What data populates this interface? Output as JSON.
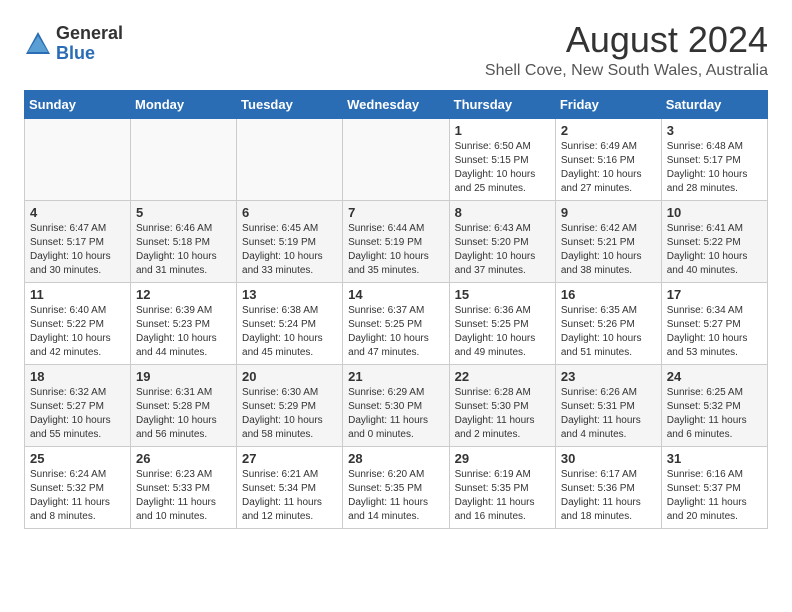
{
  "logo": {
    "general": "General",
    "blue": "Blue"
  },
  "title": {
    "month_year": "August 2024",
    "location": "Shell Cove, New South Wales, Australia"
  },
  "days_header": [
    "Sunday",
    "Monday",
    "Tuesday",
    "Wednesday",
    "Thursday",
    "Friday",
    "Saturday"
  ],
  "weeks": [
    [
      {
        "day": "",
        "info": ""
      },
      {
        "day": "",
        "info": ""
      },
      {
        "day": "",
        "info": ""
      },
      {
        "day": "",
        "info": ""
      },
      {
        "day": "1",
        "info": "Sunrise: 6:50 AM\nSunset: 5:15 PM\nDaylight: 10 hours\nand 25 minutes."
      },
      {
        "day": "2",
        "info": "Sunrise: 6:49 AM\nSunset: 5:16 PM\nDaylight: 10 hours\nand 27 minutes."
      },
      {
        "day": "3",
        "info": "Sunrise: 6:48 AM\nSunset: 5:17 PM\nDaylight: 10 hours\nand 28 minutes."
      }
    ],
    [
      {
        "day": "4",
        "info": "Sunrise: 6:47 AM\nSunset: 5:17 PM\nDaylight: 10 hours\nand 30 minutes."
      },
      {
        "day": "5",
        "info": "Sunrise: 6:46 AM\nSunset: 5:18 PM\nDaylight: 10 hours\nand 31 minutes."
      },
      {
        "day": "6",
        "info": "Sunrise: 6:45 AM\nSunset: 5:19 PM\nDaylight: 10 hours\nand 33 minutes."
      },
      {
        "day": "7",
        "info": "Sunrise: 6:44 AM\nSunset: 5:19 PM\nDaylight: 10 hours\nand 35 minutes."
      },
      {
        "day": "8",
        "info": "Sunrise: 6:43 AM\nSunset: 5:20 PM\nDaylight: 10 hours\nand 37 minutes."
      },
      {
        "day": "9",
        "info": "Sunrise: 6:42 AM\nSunset: 5:21 PM\nDaylight: 10 hours\nand 38 minutes."
      },
      {
        "day": "10",
        "info": "Sunrise: 6:41 AM\nSunset: 5:22 PM\nDaylight: 10 hours\nand 40 minutes."
      }
    ],
    [
      {
        "day": "11",
        "info": "Sunrise: 6:40 AM\nSunset: 5:22 PM\nDaylight: 10 hours\nand 42 minutes."
      },
      {
        "day": "12",
        "info": "Sunrise: 6:39 AM\nSunset: 5:23 PM\nDaylight: 10 hours\nand 44 minutes."
      },
      {
        "day": "13",
        "info": "Sunrise: 6:38 AM\nSunset: 5:24 PM\nDaylight: 10 hours\nand 45 minutes."
      },
      {
        "day": "14",
        "info": "Sunrise: 6:37 AM\nSunset: 5:25 PM\nDaylight: 10 hours\nand 47 minutes."
      },
      {
        "day": "15",
        "info": "Sunrise: 6:36 AM\nSunset: 5:25 PM\nDaylight: 10 hours\nand 49 minutes."
      },
      {
        "day": "16",
        "info": "Sunrise: 6:35 AM\nSunset: 5:26 PM\nDaylight: 10 hours\nand 51 minutes."
      },
      {
        "day": "17",
        "info": "Sunrise: 6:34 AM\nSunset: 5:27 PM\nDaylight: 10 hours\nand 53 minutes."
      }
    ],
    [
      {
        "day": "18",
        "info": "Sunrise: 6:32 AM\nSunset: 5:27 PM\nDaylight: 10 hours\nand 55 minutes."
      },
      {
        "day": "19",
        "info": "Sunrise: 6:31 AM\nSunset: 5:28 PM\nDaylight: 10 hours\nand 56 minutes."
      },
      {
        "day": "20",
        "info": "Sunrise: 6:30 AM\nSunset: 5:29 PM\nDaylight: 10 hours\nand 58 minutes."
      },
      {
        "day": "21",
        "info": "Sunrise: 6:29 AM\nSunset: 5:30 PM\nDaylight: 11 hours\nand 0 minutes."
      },
      {
        "day": "22",
        "info": "Sunrise: 6:28 AM\nSunset: 5:30 PM\nDaylight: 11 hours\nand 2 minutes."
      },
      {
        "day": "23",
        "info": "Sunrise: 6:26 AM\nSunset: 5:31 PM\nDaylight: 11 hours\nand 4 minutes."
      },
      {
        "day": "24",
        "info": "Sunrise: 6:25 AM\nSunset: 5:32 PM\nDaylight: 11 hours\nand 6 minutes."
      }
    ],
    [
      {
        "day": "25",
        "info": "Sunrise: 6:24 AM\nSunset: 5:32 PM\nDaylight: 11 hours\nand 8 minutes."
      },
      {
        "day": "26",
        "info": "Sunrise: 6:23 AM\nSunset: 5:33 PM\nDaylight: 11 hours\nand 10 minutes."
      },
      {
        "day": "27",
        "info": "Sunrise: 6:21 AM\nSunset: 5:34 PM\nDaylight: 11 hours\nand 12 minutes."
      },
      {
        "day": "28",
        "info": "Sunrise: 6:20 AM\nSunset: 5:35 PM\nDaylight: 11 hours\nand 14 minutes."
      },
      {
        "day": "29",
        "info": "Sunrise: 6:19 AM\nSunset: 5:35 PM\nDaylight: 11 hours\nand 16 minutes."
      },
      {
        "day": "30",
        "info": "Sunrise: 6:17 AM\nSunset: 5:36 PM\nDaylight: 11 hours\nand 18 minutes."
      },
      {
        "day": "31",
        "info": "Sunrise: 6:16 AM\nSunset: 5:37 PM\nDaylight: 11 hours\nand 20 minutes."
      }
    ]
  ]
}
